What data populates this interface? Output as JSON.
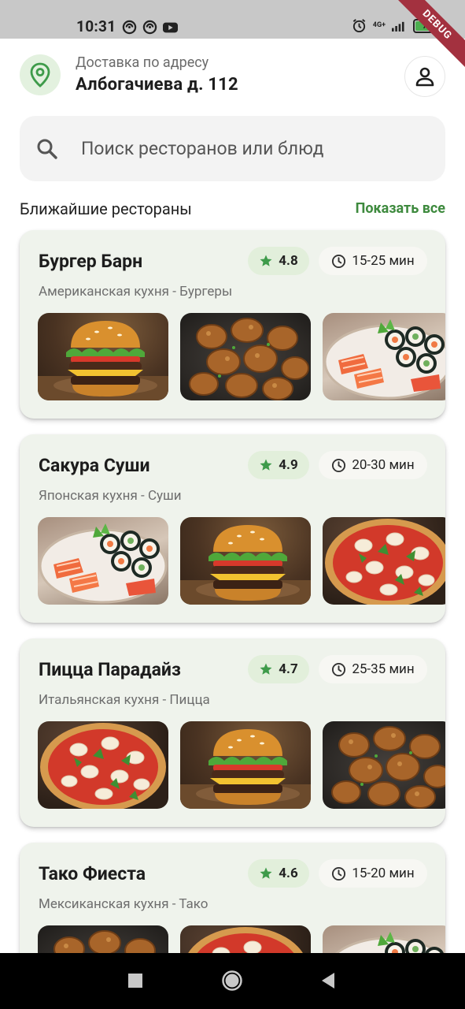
{
  "status_bar": {
    "time": "10:31",
    "network": "4G+",
    "battery": "77",
    "debug_label": "DEBUG"
  },
  "header": {
    "address_caption": "Доставка по адресу",
    "address_value": "Албогачиева д. 112",
    "location_icon": "location-pin-icon",
    "profile_icon": "person-icon"
  },
  "search": {
    "placeholder": "Поиск ресторанов или блюд"
  },
  "section": {
    "title": "Ближайшие рестораны",
    "show_all_label": "Показать все"
  },
  "colors": {
    "accent": "#3e8a3e",
    "card_bg": "#eff3ec",
    "rating_chip_bg": "#e2efdb",
    "star": "#3e9b4a"
  },
  "restaurants": [
    {
      "name": "Бургер Барн",
      "cuisine": "Американская кухня - Бургеры",
      "rating": "4.8",
      "delivery_time": "15-25 мин",
      "dishes": [
        "burger",
        "nuggets",
        "sushi"
      ]
    },
    {
      "name": "Сакура Суши",
      "cuisine": "Японская кухня - Суши",
      "rating": "4.9",
      "delivery_time": "20-30 мин",
      "dishes": [
        "sushi",
        "burger",
        "pizza"
      ]
    },
    {
      "name": "Пицца Парадайз",
      "cuisine": "Итальянская кухня - Пицца",
      "rating": "4.7",
      "delivery_time": "25-35 мин",
      "dishes": [
        "pizza",
        "burger",
        "nuggets"
      ]
    },
    {
      "name": "Тако Фиеста",
      "cuisine": "Мексиканская кухня - Тако",
      "rating": "4.6",
      "delivery_time": "15-20 мин",
      "dishes": [
        "nuggets",
        "pizza",
        "sushi"
      ]
    }
  ]
}
